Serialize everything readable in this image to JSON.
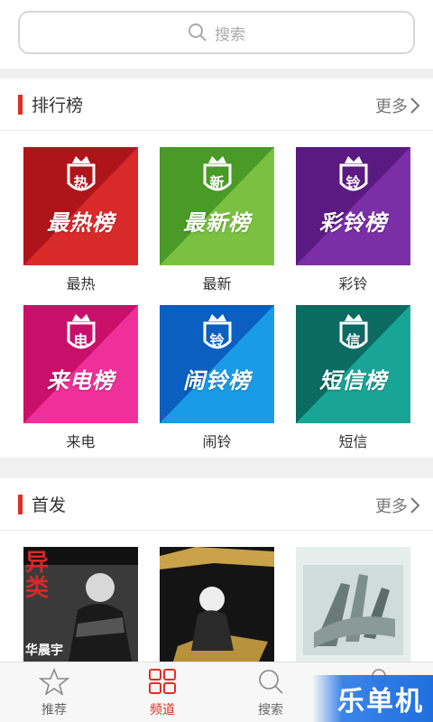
{
  "search": {
    "placeholder": "搜索"
  },
  "charts": {
    "title": "排行榜",
    "more": "更多",
    "items": [
      {
        "badge": "热",
        "name": "最热榜",
        "label": "最热",
        "color1": "#b0141b",
        "color2": "#d92a2a"
      },
      {
        "badge": "新",
        "name": "最新榜",
        "label": "最新",
        "color1": "#4a9a28",
        "color2": "#7ac142"
      },
      {
        "badge": "铃",
        "name": "彩铃榜",
        "label": "彩铃",
        "color1": "#5b1a82",
        "color2": "#7b2fa6"
      },
      {
        "badge": "电",
        "name": "来电榜",
        "label": "来电",
        "color1": "#c8106b",
        "color2": "#f0309a"
      },
      {
        "badge": "铃",
        "name": "闹铃榜",
        "label": "闹铃",
        "color1": "#0a5fc0",
        "color2": "#1a9be8"
      },
      {
        "badge": "信",
        "name": "短信榜",
        "label": "短信",
        "color1": "#0b6b63",
        "color2": "#18a596"
      }
    ]
  },
  "firsts": {
    "title": "首发",
    "more": "更多",
    "albums": [
      {
        "artist": "华晨宇",
        "title_text": "异类"
      },
      {
        "artist": "",
        "title_text": ""
      },
      {
        "artist": "",
        "title_text": ""
      }
    ]
  },
  "tabs": [
    {
      "label": "推荐",
      "icon": "star-icon",
      "active": false
    },
    {
      "label": "频道",
      "icon": "grid-icon",
      "active": true
    },
    {
      "label": "搜索",
      "icon": "search-icon",
      "active": false
    },
    {
      "label": "",
      "icon": "user-icon",
      "active": false
    }
  ],
  "watermark": "乐单机",
  "colors": {
    "accent": "#e02e24"
  }
}
